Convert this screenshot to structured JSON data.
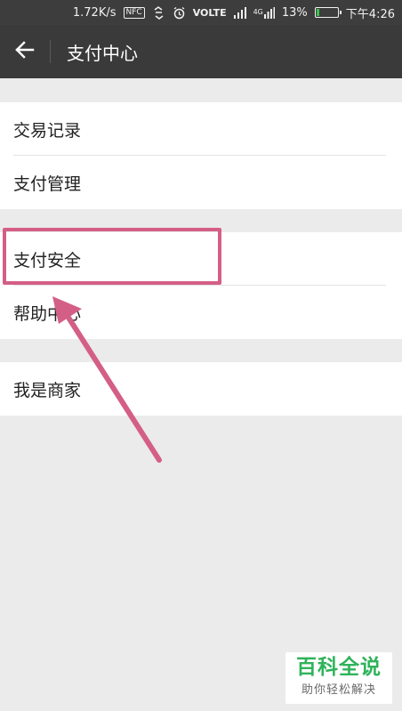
{
  "status_bar": {
    "speed": "1.72K/s",
    "nfc": "NFC",
    "volte": "VOLTE",
    "network": "4G",
    "battery_percent": "13%",
    "battery_level": 0.13,
    "time": "下午4:26"
  },
  "app_bar": {
    "back_icon": "arrow-left-icon",
    "title": "支付中心"
  },
  "groups": [
    {
      "items": [
        "交易记录",
        "支付管理"
      ]
    },
    {
      "items": [
        "支付安全",
        "帮助中心"
      ]
    },
    {
      "items": [
        "我是商家"
      ]
    }
  ],
  "annotation": {
    "highlight_color": "#d45f86",
    "highlighted_item": "支付安全"
  },
  "watermark": {
    "title": "百科全说",
    "subtitle": "助你轻松解决"
  },
  "colors": {
    "app_bar": "#3a3a3b",
    "status_bar": "#3d3d3d",
    "background": "#ebebeb",
    "battery": "#3cc251",
    "watermark_green": "#2fb35a"
  }
}
